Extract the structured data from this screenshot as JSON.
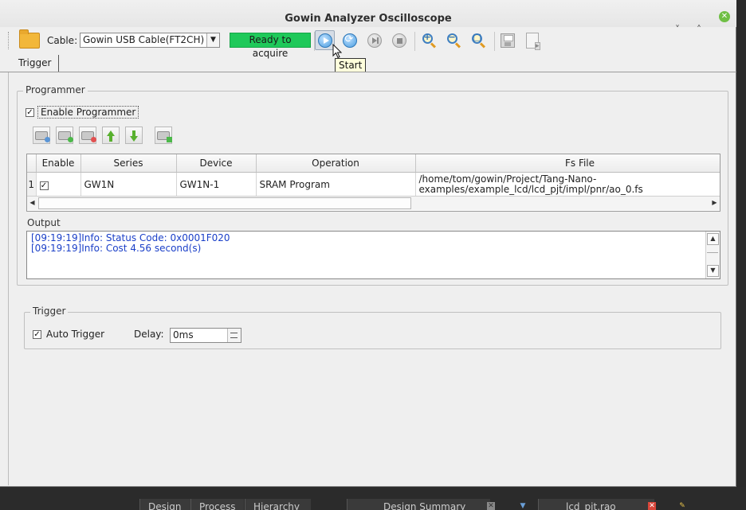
{
  "window": {
    "title": "Gowin Analyzer Oscilloscope"
  },
  "toolbar": {
    "cable_label": "Cable:",
    "cable_value": "Gowin USB Cable(FT2CH)",
    "status": "Ready to acquire",
    "status_color": "#1fc95a"
  },
  "tooltip": {
    "text": "Start"
  },
  "tabs": [
    {
      "label": "Trigger"
    }
  ],
  "programmer": {
    "group_title": "Programmer",
    "enable_label": "Enable Programmer",
    "enable_checked": true,
    "table": {
      "headers": [
        "Enable",
        "Series",
        "Device",
        "Operation",
        "Fs File"
      ],
      "rows": [
        {
          "num": "1",
          "enabled": true,
          "series": "GW1N",
          "device": "GW1N-1",
          "operation": "SRAM Program",
          "fs_file_1": "/home/tom/gowin/Project/Tang-Nano-",
          "fs_file_2": "examples/example_lcd/lcd_pjt/impl/pnr/ao_0.fs"
        }
      ]
    },
    "output_label": "Output",
    "output_lines": [
      "[09:19:19]Info: Status Code: 0x0001F020",
      "[09:19:19]Info: Cost 4.56 second(s)"
    ]
  },
  "trigger": {
    "group_title": "Trigger",
    "auto_label": "Auto Trigger",
    "auto_checked": true,
    "delay_label": "Delay:",
    "delay_value": "0ms"
  },
  "taskbar": {
    "tabs": [
      "Design",
      "Process",
      "Hierarchy",
      "Design Summary",
      "lcd_pjt.rao"
    ]
  }
}
